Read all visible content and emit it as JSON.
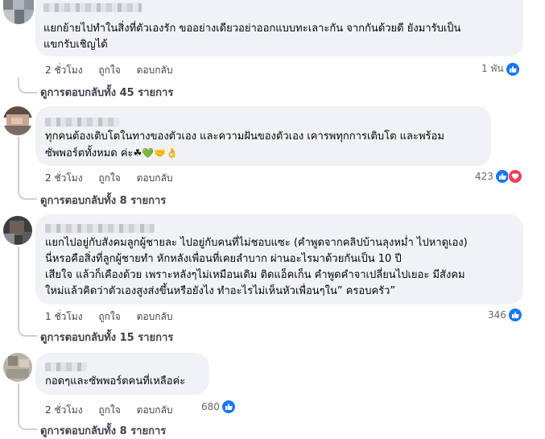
{
  "comments": [
    {
      "lines": [
        "แยกย้ายไปทำในสิ่งที่ตัวเองรัก ขออย่างเดียวอย่าออกแบบทะเลาะกัน จากกันด้วยดี ยังมารับเป็น",
        "แขกรับเชิญได้"
      ],
      "time": "2 ชั่วโมง",
      "like": "ถูกใจ",
      "reply": "ตอบกลับ",
      "reaction_count": "1 พัน",
      "reactions": [
        "like-icon"
      ],
      "replies": "ดูการตอบกลับทั้ง 45 รายการ"
    },
    {
      "lines": [
        "ทุกคนต้องเติบโตในทางของตัวเอง และความฝันของตัวเอง เคารพทุกการเติบโต และพร้อม",
        "ซัพพอร์ตทั้งหมด ค่ะ"
      ],
      "emoji": "☘💚🤝👌",
      "time": "2 ชั่วโมง",
      "like": "ถูกใจ",
      "reply": "ตอบกลับ",
      "reaction_count": "423",
      "reactions": [
        "like-icon",
        "love-icon"
      ],
      "replies": "ดูการตอบกลับทั้ง 8 รายการ"
    },
    {
      "lines": [
        "แยกไปอยู่กับสังคมลูกผู้ชายละ ไปอยู่กับคนที่ไม่ชอบแซะ (คำพูดจากคลิปบ้านลุงหม่ำ ไปหาดูเอง)",
        "นี่หรอคือสิ่งที่ลูกผู้ชายทำ หักหลังเพื่อนที่เคยลำบาก ผ่านอะไรมาด้วยกันเป็น 10 ปี",
        "เสียใจ แล้วก็เคืองด้วย เพราะหลังๆไม่เหมือนเดิม ติดแอ็คเก็น คำพูดคำจาเปลี่ยนไปเยอะ มีสังคม",
        "ใหม่แล้วคิดว่าตัวเองสูงส่งขึ้นหรือยังไง ทำอะไรไม่เห็นหัวเพื่อนๆใน” ครอบครัว”"
      ],
      "time": "1 ชั่วโมง",
      "like": "ถูกใจ",
      "reply": "ตอบกลับ",
      "reaction_count": "346",
      "reactions": [
        "like-icon"
      ],
      "replies": "ดูการตอบกลับทั้ง 15 รายการ"
    },
    {
      "lines": [
        "กอดๆและซัพพอร์ตคนที่เหลือค่ะ"
      ],
      "time": "2 ชั่วโมง",
      "like": "ถูกใจ",
      "reply": "ตอบกลับ",
      "reaction_count": "680",
      "reactions": [
        "like-icon"
      ],
      "replies": "ดูการตอบกลับทั้ง 8 รายการ"
    }
  ],
  "colors": {
    "like": "#1877f2",
    "love": "#f33e58",
    "bubble": "#f0f2f5"
  }
}
